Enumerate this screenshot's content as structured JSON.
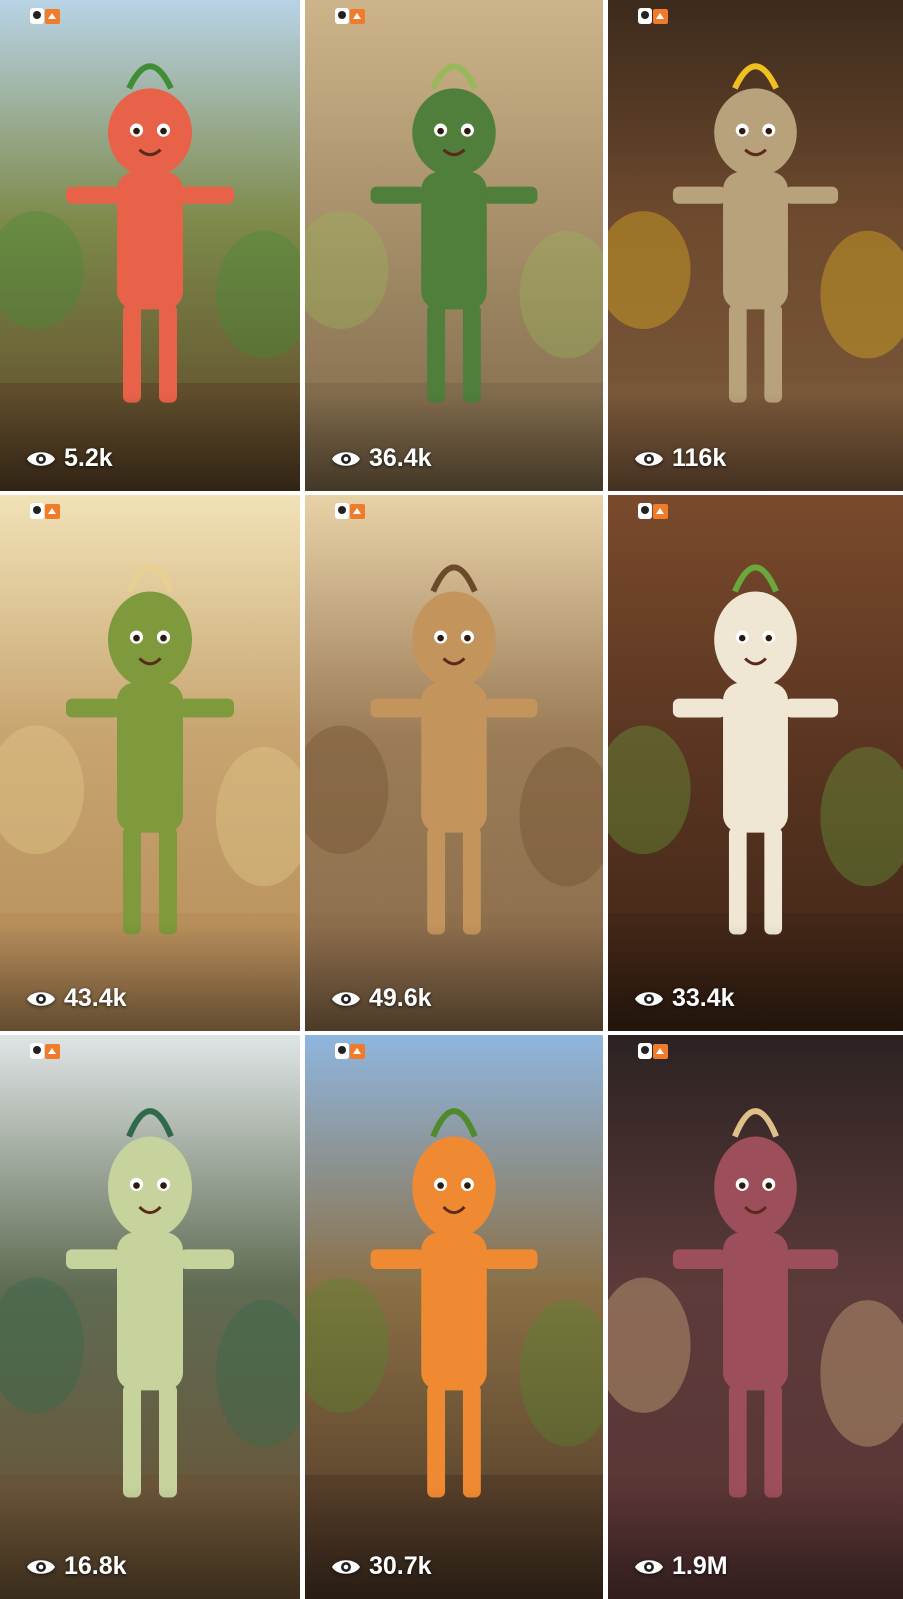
{
  "feed": {
    "items": [
      {
        "views": "5.2k",
        "scene": "mango-character-orchard",
        "bg": "#7e8a4a",
        "sky": "#b9d3e6",
        "ground": "#5a4126",
        "figure": "#e8624a",
        "accent": "#3f8d35"
      },
      {
        "views": "36.4k",
        "scene": "aloe-vera-figure-market",
        "bg": "#a7906a",
        "sky": "#cdb48a",
        "ground": "#7a6547",
        "figure": "#4f7f3a",
        "accent": "#98b85a"
      },
      {
        "views": "116k",
        "scene": "garlic-figure-market",
        "bg": "#6e4a2e",
        "sky": "#3c2a1c",
        "ground": "#7b5a3c",
        "figure": "#b8a27c",
        "accent": "#f0c020"
      },
      {
        "views": "43.4k",
        "scene": "coconut-bodybuilder-market",
        "bg": "#c7a470",
        "sky": "#f1e2b7",
        "ground": "#b58b58",
        "figure": "#7e9a3c",
        "accent": "#e8d090"
      },
      {
        "views": "49.6k",
        "scene": "peanut-figure-market",
        "bg": "#9b7c57",
        "sky": "#e8d2a8",
        "ground": "#8a6b4b",
        "figure": "#c3945c",
        "accent": "#6b4a2c"
      },
      {
        "views": "33.4k",
        "scene": "radish-judge-courtroom",
        "bg": "#5b3622",
        "sky": "#7a4a2c",
        "ground": "#3e2416",
        "figure": "#efe7d4",
        "accent": "#6aa83e"
      },
      {
        "views": "16.8k",
        "scene": "kohlrabi-figure-market",
        "bg": "#5f6b52",
        "sky": "#dfe5e6",
        "ground": "#6a5033",
        "figure": "#c7d39c",
        "accent": "#2f6a4a"
      },
      {
        "views": "30.7k",
        "scene": "carrot-character-field",
        "bg": "#8a6f45",
        "sky": "#8fb6df",
        "ground": "#4a3424",
        "figure": "#f08a32",
        "accent": "#4f8a2c"
      },
      {
        "views": "1.9M",
        "scene": "banana-flower-woman-market",
        "bg": "#5c3b3a",
        "sky": "#2c2222",
        "ground": "#5a3534",
        "figure": "#9c4f5a",
        "accent": "#e0c08a"
      }
    ]
  },
  "colors": {
    "text": "#ffffff",
    "divider": "#ffffff"
  },
  "icons": {
    "views": "eye-icon",
    "badge": "app-badge-icon"
  }
}
